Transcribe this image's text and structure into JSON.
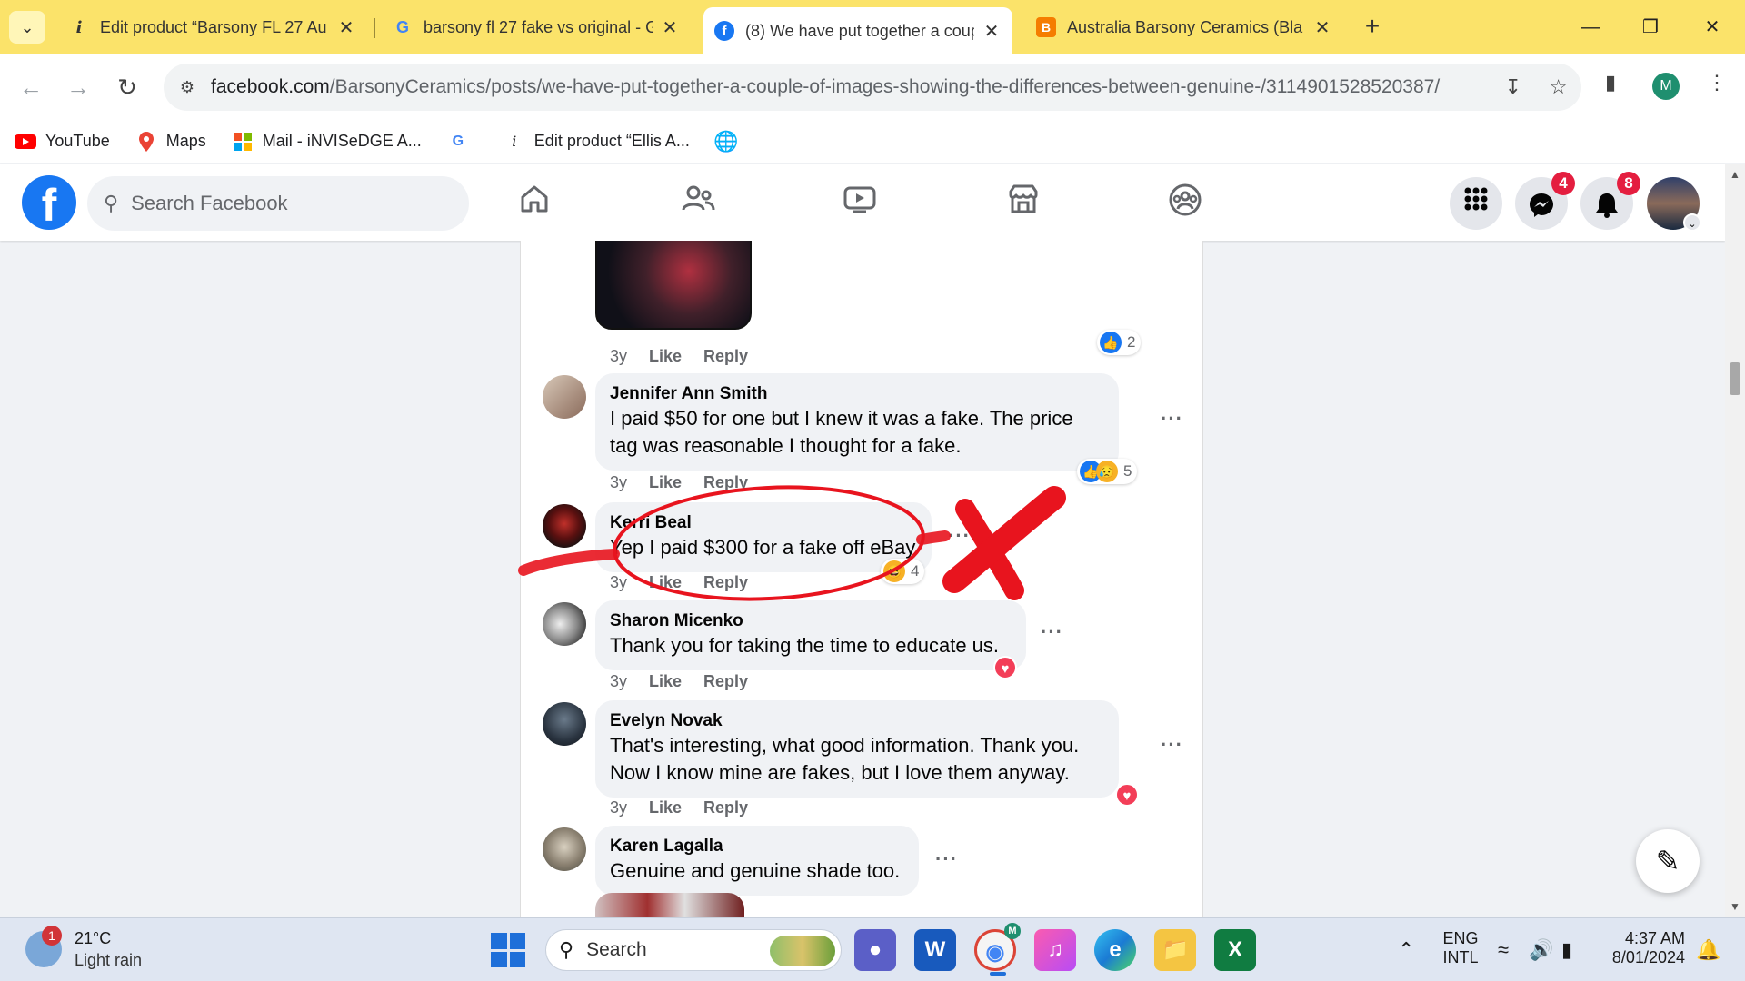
{
  "browser": {
    "tabs": [
      {
        "title": "Edit product “Barsony FL 27 Au",
        "icon": "info-icon",
        "active": false
      },
      {
        "title": "barsony fl 27 fake vs original - G",
        "icon": "google-icon",
        "active": false
      },
      {
        "title": "(8) We have put together a coup",
        "icon": "facebook-icon",
        "active": true
      },
      {
        "title": "Australia Barsony Ceramics (Bla",
        "icon": "blogger-icon",
        "active": false
      }
    ],
    "url_host": "facebook.com",
    "url_path": "/BarsonyCeramics/posts/we-have-put-together-a-couple-of-images-showing-the-differences-between-genuine-/3114901528520387/",
    "profile_initial": "M",
    "bookmarks": [
      {
        "label": "YouTube",
        "icon": "youtube-icon"
      },
      {
        "label": "Maps",
        "icon": "maps-icon"
      },
      {
        "label": "Mail - iNVISeDGE A...",
        "icon": "microsoft-icon"
      },
      {
        "label": "",
        "icon": "google-icon"
      },
      {
        "label": "Edit product “Ellis A...",
        "icon": "info-icon"
      },
      {
        "label": "",
        "icon": "globe-icon"
      }
    ]
  },
  "facebook": {
    "search_placeholder": "Search Facebook",
    "messenger_badge": "4",
    "notifications_badge": "8",
    "brand_color": "#1877f2"
  },
  "comments": [
    {
      "name": "",
      "text": "",
      "time": "3y",
      "like": "Like",
      "reply": "Reply",
      "reaction_count": "2"
    },
    {
      "name": "Jennifer Ann Smith",
      "text": "I paid $50 for one but I knew it was a fake. The price tag was reasonable I thought for a fake.",
      "time": "3y",
      "like": "Like",
      "reply": "Reply",
      "reaction_count": "5"
    },
    {
      "name": "Kerri Beal",
      "text": "Yep I paid $300 for a fake off eBay",
      "time": "3y",
      "like": "Like",
      "reply": "Reply",
      "reaction_count": "4"
    },
    {
      "name": "Sharon Micenko",
      "text": "Thank you for taking the time to educate us.",
      "time": "3y",
      "like": "Like",
      "reply": "Reply",
      "reaction_count": ""
    },
    {
      "name": "Evelyn Novak",
      "text": "That's interesting, what good information. Thank you. Now I know mine are fakes, but I love them anyway.",
      "time": "3y",
      "like": "Like",
      "reply": "Reply",
      "reaction_count": ""
    },
    {
      "name": "Karen Lagalla",
      "text": "Genuine and genuine shade too.",
      "time": "",
      "like": "",
      "reply": "",
      "reaction_count": ""
    }
  ],
  "taskbar": {
    "weather_temp": "21°C",
    "weather_desc": "Light rain",
    "weather_badge": "1",
    "search_placeholder": "Search",
    "lang_top": "ENG",
    "lang_bottom": "INTL",
    "time": "4:37 AM",
    "date": "8/01/2024",
    "chrome_badge": "M"
  },
  "annotation_color": "#e8141e"
}
